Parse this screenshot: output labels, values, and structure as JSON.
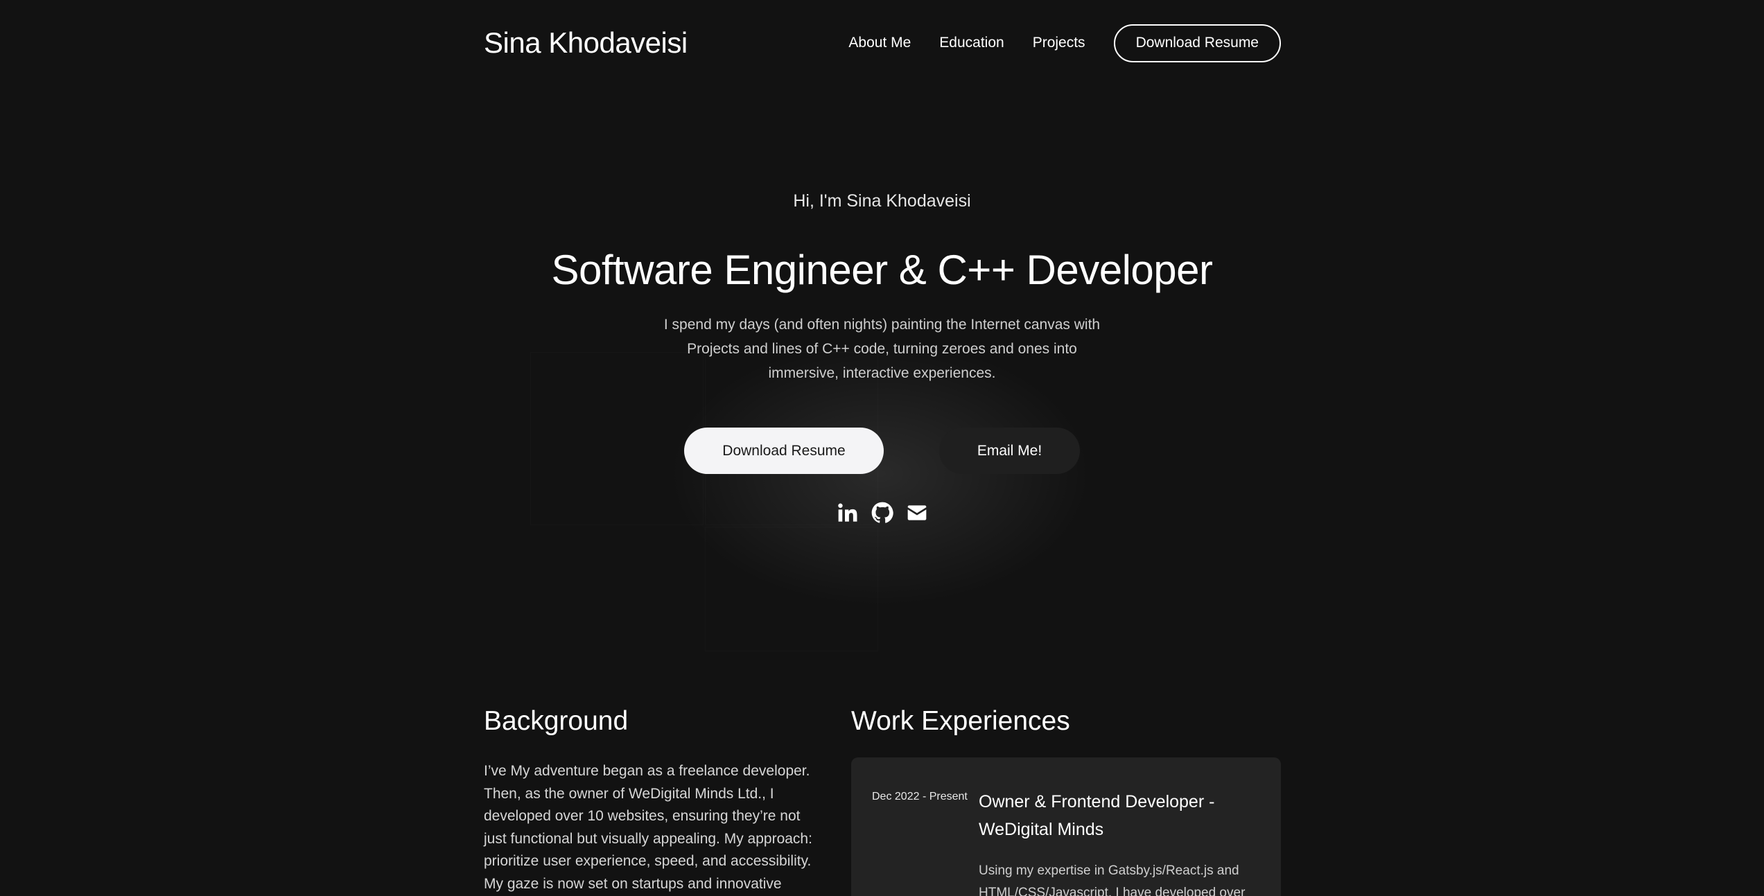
{
  "header": {
    "brand": "Sina Khodaveisi",
    "nav": [
      "About Me",
      "Education",
      "Projects"
    ],
    "cta": "Download Resume"
  },
  "hero": {
    "greeting": "Hi, I'm Sina Khodaveisi",
    "title": "Software Engineer & C++ Developer",
    "description": "I spend my days (and often nights) painting the Internet canvas with Projects and lines of C++ code, turning zeroes and ones into immersive, interactive experiences.",
    "primary_button": "Download Resume",
    "secondary_button": "Email Me!",
    "socials": [
      "linkedin-icon",
      "github-icon",
      "mail-icon"
    ]
  },
  "background": {
    "title": "Background",
    "text": "I’ve My adventure began as a freelance developer. Then, as the owner of WeDigital Minds Ltd., I developed over 10 websites, ensuring they’re not just functional but visually appealing. My approach: prioritize user experience, speed, and accessibility. My gaze is now set on startups and innovative companies, seeking to join a dedicated team."
  },
  "work": {
    "title": "Work Experiences",
    "items": [
      {
        "date": "Dec 2022 - Present",
        "role": "Owner & Frontend Developer - WeDigital Minds",
        "description": "Using my expertise in Gatsby.js/React.js and HTML/CSS/Javascript, I have developed over"
      }
    ]
  },
  "colors": {
    "background": "#121212",
    "card": "#232323",
    "primary_button": "#f4f4f6",
    "secondary_button": "#1f1f1f",
    "text": "#ffffff"
  }
}
